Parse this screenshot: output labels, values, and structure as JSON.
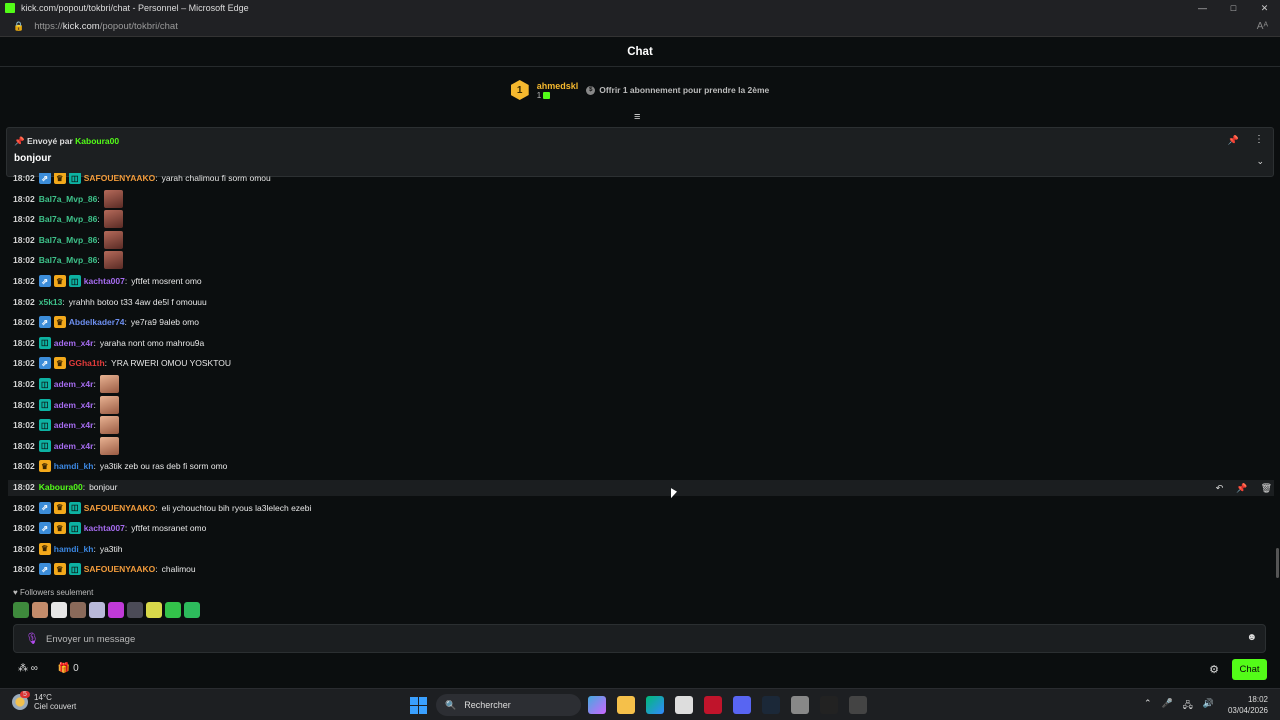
{
  "window": {
    "title": "kick.com/popout/tokbri/chat - Personnel – Microsoft Edge",
    "controls": [
      "—",
      "□",
      "✕"
    ]
  },
  "addressbar": {
    "url_prefix": "https://",
    "url_domain": "kick.com",
    "url_path": "/popout/tokbri/chat"
  },
  "header": {
    "title": "Chat"
  },
  "gifter": {
    "rank": "1",
    "name": "ahmedskl",
    "count": "1",
    "offer": "Offrir 1 abonnement pour prendre la 2ème"
  },
  "pinned": {
    "prefix": "Envoyé par",
    "author": "Kaboura00",
    "message": "bonjour"
  },
  "colors": {
    "accent": "#53fc18"
  },
  "messages": [
    {
      "time": "18:02",
      "badges": [
        "vip",
        "crown",
        "sub"
      ],
      "user": "SAFOUENYAAKO",
      "color": "#f39c3c",
      "text": "yarah chalimou fi sorm omou",
      "emotes": 0
    },
    {
      "time": "18:02",
      "badges": [],
      "user": "Bal7a_Mvp_86",
      "color": "#3ec28a",
      "text": "",
      "emotes": 1
    },
    {
      "time": "18:02",
      "badges": [],
      "user": "Bal7a_Mvp_86",
      "color": "#3ec28a",
      "text": "",
      "emotes": 1
    },
    {
      "time": "18:02",
      "badges": [],
      "user": "Bal7a_Mvp_86",
      "color": "#3ec28a",
      "text": "",
      "emotes": 1
    },
    {
      "time": "18:02",
      "badges": [],
      "user": "Bal7a_Mvp_86",
      "color": "#3ec28a",
      "text": "",
      "emotes": 1
    },
    {
      "time": "18:02",
      "badges": [
        "vip",
        "crown",
        "sub"
      ],
      "user": "kachta007",
      "color": "#a66cf0",
      "text": "yftfet mosrent omo",
      "emotes": 0
    },
    {
      "time": "18:02",
      "badges": [],
      "user": "x5k13",
      "color": "#3ec28a",
      "text": "yrahhh botoo t33 4aw de5l f omouuu",
      "emotes": 0
    },
    {
      "time": "18:02",
      "badges": [
        "vip",
        "crown"
      ],
      "user": "Abdelkader74",
      "color": "#6d8ff0",
      "text": "ye7ra9 9aleb omo",
      "emotes": 0
    },
    {
      "time": "18:02",
      "badges": [
        "sub"
      ],
      "user": "adem_x4r",
      "color": "#a66cf0",
      "text": "yaraha nont omo mahrou9a",
      "emotes": 0
    },
    {
      "time": "18:02",
      "badges": [
        "vip",
        "crown"
      ],
      "user": "GGha1th",
      "color": "#e23b3b",
      "text": "YRA RWERI OMOU YOSKTOU",
      "emotes": 0
    },
    {
      "time": "18:02",
      "badges": [
        "sub"
      ],
      "user": "adem_x4r",
      "color": "#a66cf0",
      "text": "",
      "emotes": 1
    },
    {
      "time": "18:02",
      "badges": [
        "sub"
      ],
      "user": "adem_x4r",
      "color": "#a66cf0",
      "text": "",
      "emotes": 1
    },
    {
      "time": "18:02",
      "badges": [
        "sub"
      ],
      "user": "adem_x4r",
      "color": "#a66cf0",
      "text": "",
      "emotes": 1
    },
    {
      "time": "18:02",
      "badges": [
        "sub"
      ],
      "user": "adem_x4r",
      "color": "#a66cf0",
      "text": "",
      "emotes": 1
    },
    {
      "time": "18:02",
      "badges": [
        "crown"
      ],
      "user": "hamdi_kh",
      "color": "#3b86e0",
      "text": "ya3tik zeb ou ras deb fi sorm omo",
      "emotes": 0
    },
    {
      "time": "18:02",
      "badges": [],
      "user": "Kaboura00",
      "color": "#53fc18",
      "text": "bonjour",
      "emotes": 0
    },
    {
      "time": "18:02",
      "badges": [
        "vip",
        "crown",
        "sub"
      ],
      "user": "SAFOUENYAAKO",
      "color": "#f39c3c",
      "text": "eli ychouchtou bih ryous la3lelech ezebi",
      "emotes": 0
    },
    {
      "time": "18:02",
      "badges": [
        "vip",
        "crown",
        "sub"
      ],
      "user": "kachta007",
      "color": "#a66cf0",
      "text": "yftfet mosranet omo",
      "emotes": 0
    },
    {
      "time": "18:02",
      "badges": [
        "crown"
      ],
      "user": "hamdi_kh",
      "color": "#3b86e0",
      "text": "ya3tih",
      "emotes": 0
    },
    {
      "time": "18:02",
      "badges": [
        "vip",
        "crown",
        "sub"
      ],
      "user": "SAFOUENYAAKO",
      "color": "#f39c3c",
      "text": "chalimou",
      "emotes": 0
    }
  ],
  "chat_mode": "Followers seulement",
  "input": {
    "placeholder": "Envoyer un message"
  },
  "footer": {
    "count": "0",
    "infinity": "∞",
    "chat_button": "Chat"
  },
  "taskbar": {
    "weather": {
      "temp": "14°C",
      "desc": "Ciel couvert",
      "badge": "5"
    },
    "search_label": "Rechercher",
    "time": "18:02",
    "date": "03/04/2026"
  }
}
